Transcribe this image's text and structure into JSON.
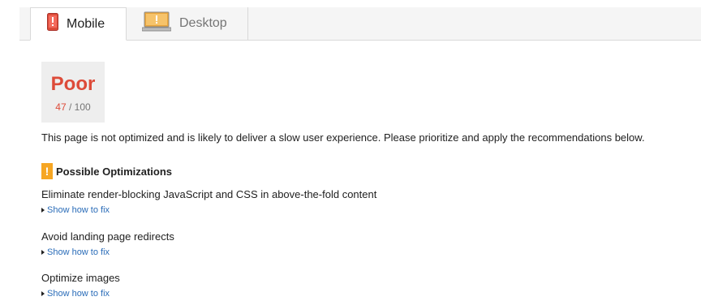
{
  "tabs": [
    {
      "label": "Mobile",
      "icon": "mobile-phone-icon",
      "selected": true
    },
    {
      "label": "Desktop",
      "icon": "desktop-monitor-icon",
      "selected": false
    }
  ],
  "score": {
    "grade": "Poor",
    "value": "47",
    "separator": "/ 100"
  },
  "summary": "This page is not optimized and is likely to deliver a slow user experience. Please prioritize and apply the recommendations below.",
  "section": {
    "badge": "!",
    "title": "Possible Optimizations"
  },
  "rules": [
    {
      "title": "Eliminate render-blocking JavaScript and CSS in above-the-fold content",
      "link": "Show how to fix"
    },
    {
      "title": "Avoid landing page redirects",
      "link": "Show how to fix"
    },
    {
      "title": "Optimize images",
      "link": "Show how to fix"
    }
  ],
  "colors": {
    "poor": "#dd4b39",
    "warning": "#f6a623",
    "link": "#2a6cb8"
  }
}
